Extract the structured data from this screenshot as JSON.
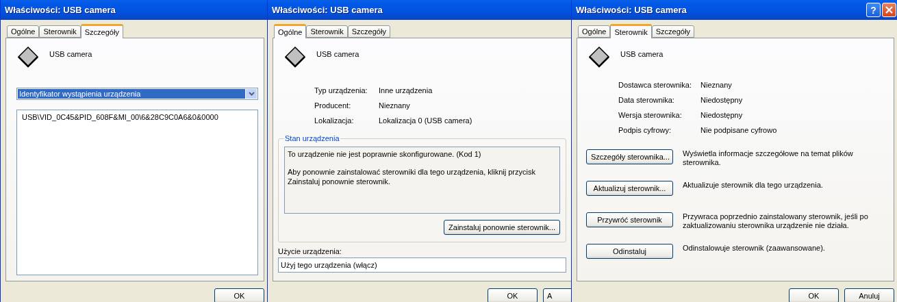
{
  "windows": [
    {
      "kind": "details",
      "title": "Właściwości: USB camera",
      "tabs": [
        {
          "label": "Ogólne",
          "selected": false
        },
        {
          "label": "Sterownik",
          "selected": false
        },
        {
          "label": "Szczegóły",
          "selected": true
        }
      ],
      "device_name": "USB camera",
      "property_select": {
        "value": "Identyfikator wystąpienia urządzenia"
      },
      "values": [
        "USB\\VID_0C45&PID_608F&MI_00\\6&28C9C0A6&0&0000"
      ],
      "buttons": [
        "OK"
      ]
    },
    {
      "kind": "general",
      "title": "Właściwości: USB camera",
      "tabs": [
        {
          "label": "Ogólne",
          "selected": true
        },
        {
          "label": "Sterownik",
          "selected": false
        },
        {
          "label": "Szczegóły",
          "selected": false
        }
      ],
      "device_name": "USB camera",
      "properties": [
        {
          "label": "Typ urządzenia:",
          "value": "Inne urządzenia"
        },
        {
          "label": "Producent:",
          "value": "Nieznany"
        },
        {
          "label": "Lokalizacja:",
          "value": "Lokalizacja 0 (USB camera)"
        }
      ],
      "status": {
        "title": "Stan urządzenia",
        "text": [
          "To urządzenie nie jest poprawnie skonfigurowane. (Kod 1)",
          "Aby ponownie zainstalować sterowniki dla tego urządzenia, kliknij przycisk Zainstaluj ponownie sterownik."
        ],
        "button": "Zainstaluj ponownie sterownik..."
      },
      "usage": {
        "label": "Użycie urządzenia:",
        "value": "Użyj tego urządzenia (włącz)"
      },
      "buttons": [
        "OK",
        "A"
      ]
    },
    {
      "kind": "driver",
      "title": "Właściwości: USB camera",
      "title_buttons": [
        {
          "kind": "help",
          "label": "?"
        },
        {
          "kind": "close"
        }
      ],
      "tabs": [
        {
          "label": "Ogólne",
          "selected": false
        },
        {
          "label": "Sterownik",
          "selected": true
        },
        {
          "label": "Szczegóły",
          "selected": false
        }
      ],
      "device_name": "USB camera",
      "properties": [
        {
          "label": "Dostawca sterownika:",
          "value": "Nieznany"
        },
        {
          "label": "Data sterownika:",
          "value": "Niedostępny"
        },
        {
          "label": "Wersja sterownika:",
          "value": "Niedostępny"
        },
        {
          "label": "Podpis cyfrowy:",
          "value": "Nie podpisane cyfrowo"
        }
      ],
      "actions": [
        {
          "button": "Szczegóły sterownika...",
          "description": "Wyświetla informacje szczegółowe na temat plików sterownika."
        },
        {
          "button": "Aktualizuj sterownik...",
          "description": "Aktualizuje sterownik dla tego urządzenia."
        },
        {
          "button": "Przywróć sterownik",
          "description": "Przywraca poprzednio zainstalowany sterownik, jeśli po zaktualizowaniu sterownika urządzenie nie działa."
        },
        {
          "button": "Odinstaluj",
          "description": "Odinstalowuje sterownik (zaawansowane)."
        }
      ],
      "buttons": [
        "OK",
        "Anuluj"
      ]
    }
  ]
}
